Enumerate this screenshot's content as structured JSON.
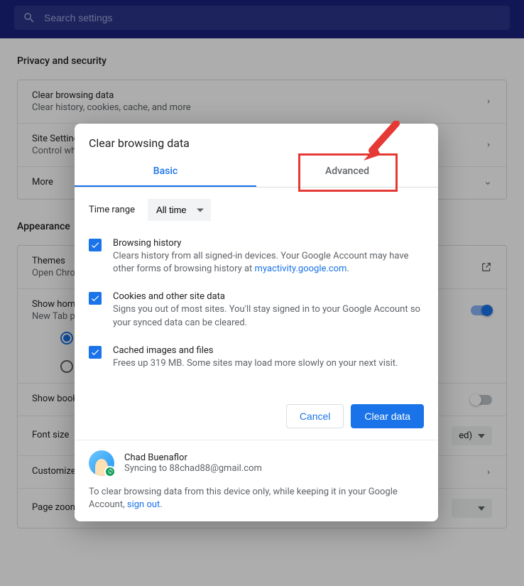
{
  "search": {
    "placeholder": "Search settings"
  },
  "sections": {
    "privacy_title": "Privacy and security",
    "clear_data": {
      "title": "Clear browsing data",
      "sub": "Clear history, cookies, cache, and more"
    },
    "site_settings": {
      "title": "Site Settings",
      "sub": "Control wh"
    },
    "more": {
      "title": "More"
    },
    "appearance_title": "Appearance",
    "themes": {
      "title": "Themes",
      "sub": "Open Chro"
    },
    "show_home": {
      "title": "Show home",
      "sub": "New Tab p"
    },
    "show_book": {
      "title": "Show book"
    },
    "font_size": {
      "title": "Font size",
      "value_suffix": "ed)"
    },
    "customize": {
      "title": "Customize"
    },
    "page_zoom": {
      "title": "Page zoom"
    }
  },
  "dialog": {
    "title": "Clear browsing data",
    "tab_basic": "Basic",
    "tab_advanced": "Advanced",
    "range_label": "Time range",
    "range_value": "All time",
    "items": [
      {
        "title": "Browsing history",
        "sub_pre": "Clears history from all signed-in devices. Your Google Account may have other forms of browsing history at ",
        "link": "myactivity.google.com",
        "sub_post": "."
      },
      {
        "title": "Cookies and other site data",
        "sub": "Signs you out of most sites. You'll stay signed in to your Google Account so your synced data can be cleared."
      },
      {
        "title": "Cached images and files",
        "sub": "Frees up 319 MB. Some sites may load more slowly on your next visit."
      }
    ],
    "cancel": "Cancel",
    "clear": "Clear data",
    "profile_name": "Chad Buenaflor",
    "profile_sub": "Syncing to 88chad88@gmail.com",
    "footer_pre": "To clear browsing data from this device only, while keeping it in your Google Account, ",
    "footer_link": "sign out",
    "footer_post": "."
  }
}
